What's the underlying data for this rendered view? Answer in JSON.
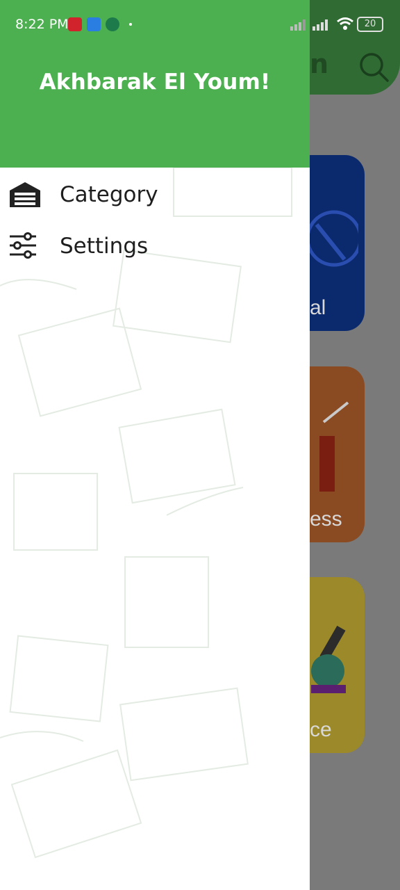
{
  "status_bar": {
    "time": "8:22 PM",
    "notification_icons": [
      "pinterest-icon",
      "app-store-icon",
      "premier-league-icon"
    ],
    "battery": "20"
  },
  "app": {
    "title_partial": "n",
    "cards": [
      {
        "label_partial": "al",
        "color": "#0b2a6e"
      },
      {
        "label_partial": "ess",
        "color": "#8a4a22"
      },
      {
        "label_partial": "ce",
        "color": "#9c8a2a"
      }
    ]
  },
  "drawer": {
    "title": "Akhbarak El Youm!",
    "header_color": "#4caf50",
    "items": [
      {
        "label": "Category",
        "icon": "garage-icon"
      },
      {
        "label": "Settings",
        "icon": "sliders-icon"
      }
    ]
  }
}
